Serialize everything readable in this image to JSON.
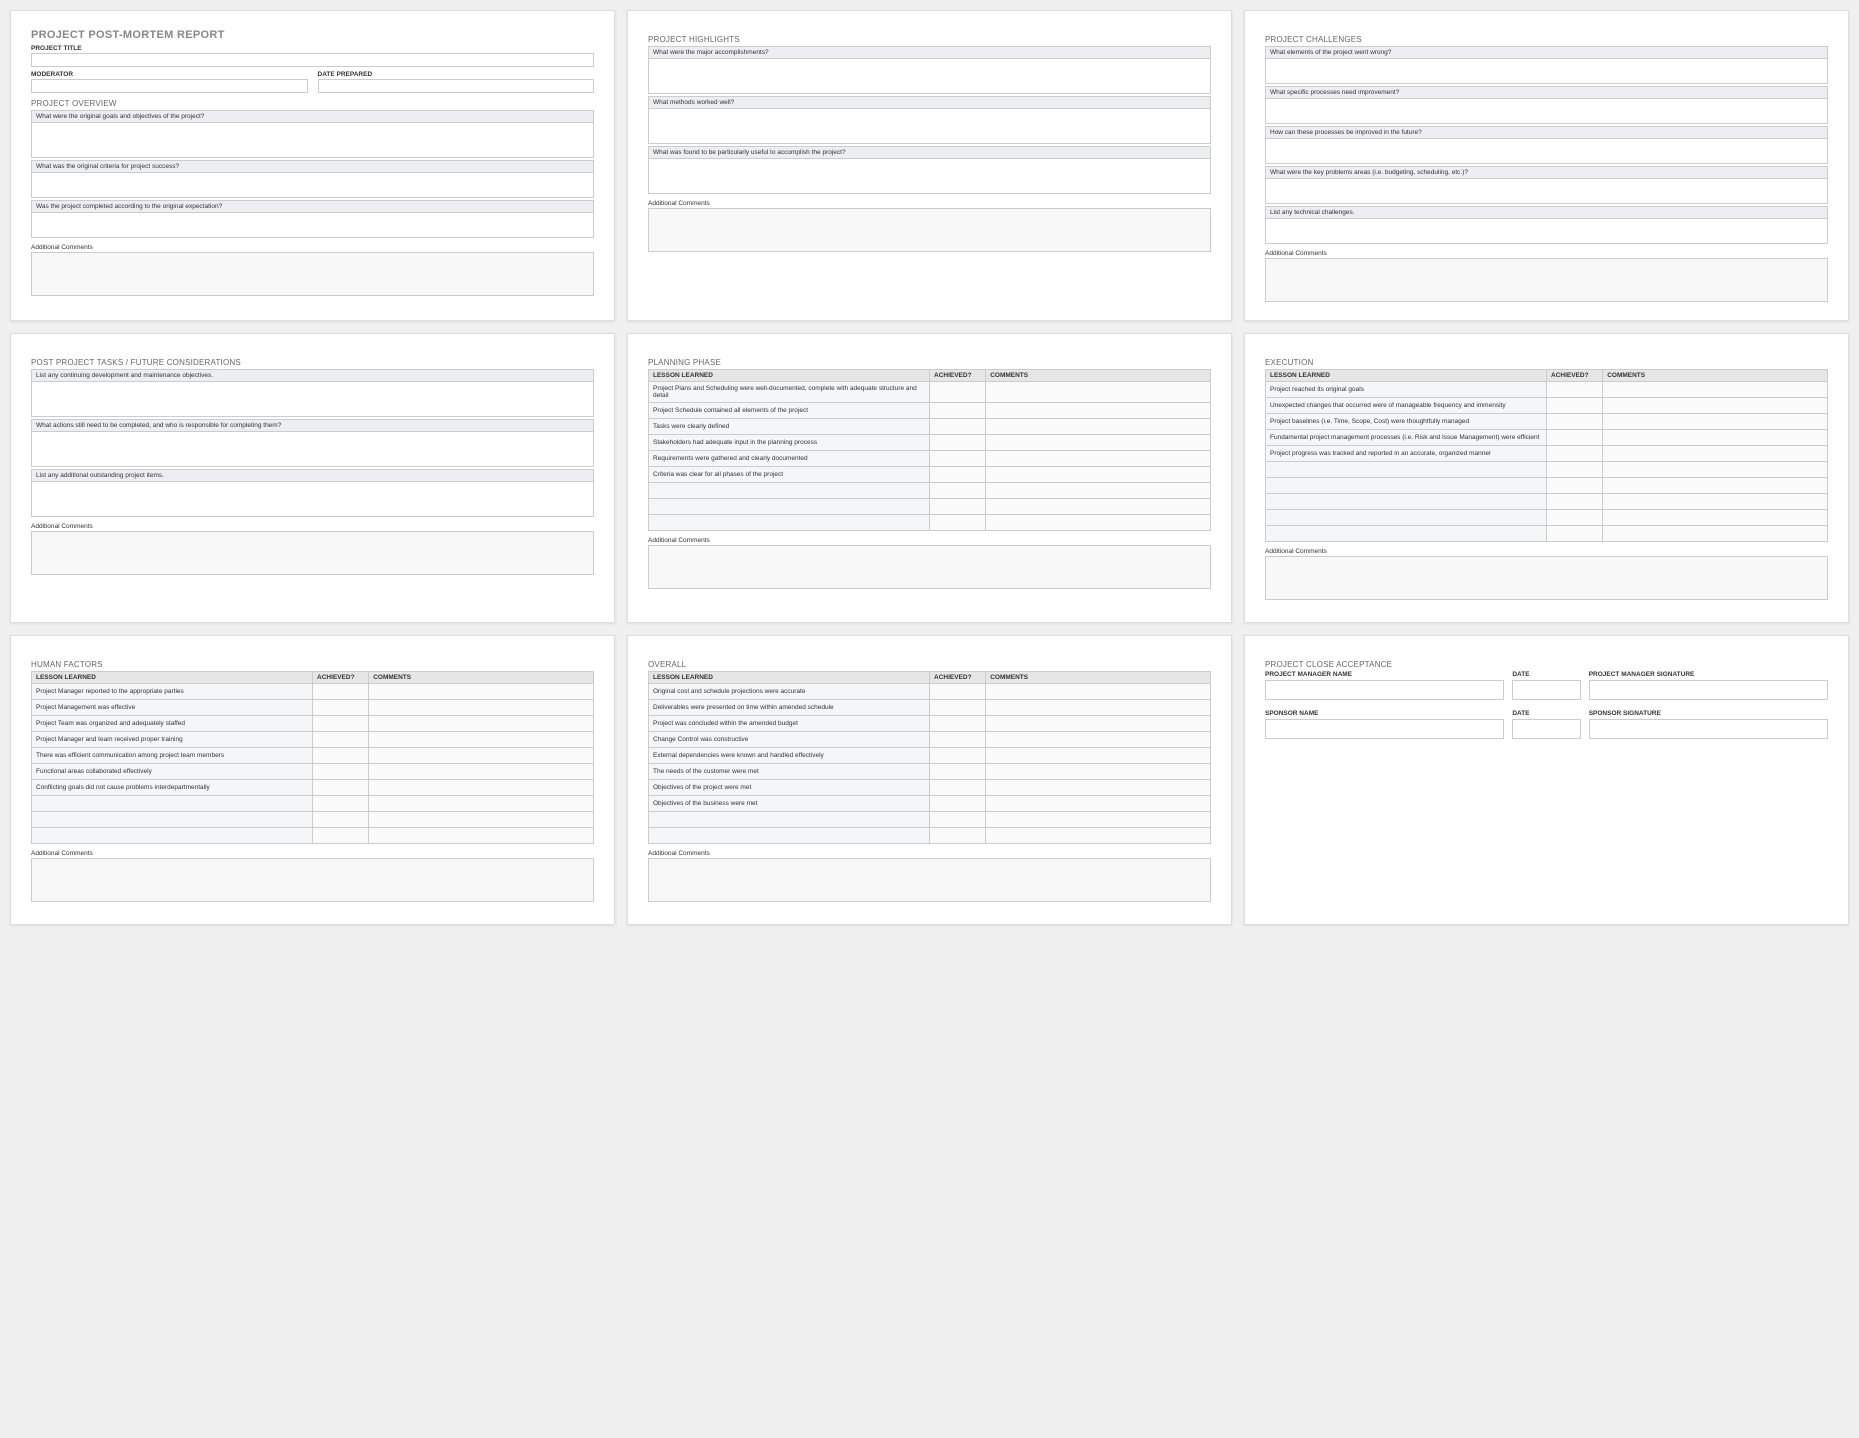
{
  "report": {
    "title": "PROJECT POST-MORTEM REPORT",
    "projectTitleLabel": "PROJECT TITLE",
    "moderatorLabel": "MODERATOR",
    "datePreparedLabel": "DATE PREPARED",
    "overview": {
      "heading": "PROJECT OVERVIEW",
      "q1": "What were the original goals and objectives of the project?",
      "q2": "What was the original criteria for project success?",
      "q3": "Was the project completed according to the original expectation?",
      "commentsLabel": "Additional Comments"
    }
  },
  "highlights": {
    "heading": "PROJECT HIGHLIGHTS",
    "q1": "What were the major accomplishments?",
    "q2": "What methods worked well?",
    "q3": "What was found to be particularly useful to accomplish the project?",
    "commentsLabel": "Additional Comments"
  },
  "challenges": {
    "heading": "PROJECT CHALLENGES",
    "q1": "What elements of the project went wrong?",
    "q2": "What specific processes need improvement?",
    "q3": "How can these processes be improved in the future?",
    "q4": "What were the key problems areas (i.e. budgeting, scheduling, etc.)?",
    "q5": "List any technical challenges.",
    "commentsLabel": "Additional Comments"
  },
  "postTasks": {
    "heading": "POST PROJECT TASKS / FUTURE CONSIDERATIONS",
    "q1": "List any continuing development and maintenance objectives.",
    "q2": "What actions still need to be completed, and who is responsible for completing them?",
    "q3": "List any additional outstanding project items.",
    "commentsLabel": "Additional Comments"
  },
  "planning": {
    "heading": "PLANNING PHASE",
    "cols": {
      "lesson": "LESSON LEARNED",
      "achieved": "ACHIEVED?",
      "comments": "COMMENTS"
    },
    "rows": [
      "Project Plans and Scheduling were well-documented, complete with adequate structure and detail",
      "Project Schedule contained all elements of the project",
      "Tasks were clearly defined",
      "Stakeholders had adequate input in the planning process",
      "Requirements were gathered and clearly documented",
      "Criteria was clear for all phases of the project",
      "",
      "",
      ""
    ],
    "commentsLabel": "Additional Comments"
  },
  "execution": {
    "heading": "EXECUTION",
    "cols": {
      "lesson": "LESSON LEARNED",
      "achieved": "ACHIEVED?",
      "comments": "COMMENTS"
    },
    "rows": [
      "Project reached its original goals",
      "Unexpected changes that occurred were of manageable frequency and immensity",
      "Project baselines (i.e. Time, Scope, Cost) were thoughtfully managed",
      "Fundamental project management processes (i.e. Risk and Issue Management) were efficient",
      "Project progress was tracked and reported in an accurate, organized manner",
      "",
      "",
      "",
      "",
      ""
    ],
    "commentsLabel": "Additional Comments"
  },
  "human": {
    "heading": "HUMAN FACTORS",
    "cols": {
      "lesson": "LESSON LEARNED",
      "achieved": "ACHIEVED?",
      "comments": "COMMENTS"
    },
    "rows": [
      "Project Manager reported to the appropriate parties",
      "Project Management was effective",
      "Project Team was organized and adequately staffed",
      "Project Manager and team received proper training",
      "There was efficient communication among project team members",
      "Functional areas collaborated effectively",
      "Conflicting goals did not cause problems interdepartmentally",
      "",
      "",
      ""
    ],
    "commentsLabel": "Additional Comments"
  },
  "overall": {
    "heading": "OVERALL",
    "cols": {
      "lesson": "LESSON LEARNED",
      "achieved": "ACHIEVED?",
      "comments": "COMMENTS"
    },
    "rows": [
      "Original cost and schedule projections were accurate",
      "Deliverables were presented on time within amended schedule",
      "Project was concluded within the amended budget",
      "Change Control was constructive",
      "External dependencies were known and handled effectively",
      "The needs of the customer were met",
      "Objectives of the project were met",
      "Objectives of the business were met",
      "",
      ""
    ],
    "commentsLabel": "Additional Comments"
  },
  "close": {
    "heading": "PROJECT CLOSE ACCEPTANCE",
    "pmName": "PROJECT MANAGER NAME",
    "date": "DATE",
    "pmSig": "PROJECT MANAGER SIGNATURE",
    "sponsorName": "SPONSOR NAME",
    "sponsorSig": "SPONSOR SIGNATURE"
  }
}
